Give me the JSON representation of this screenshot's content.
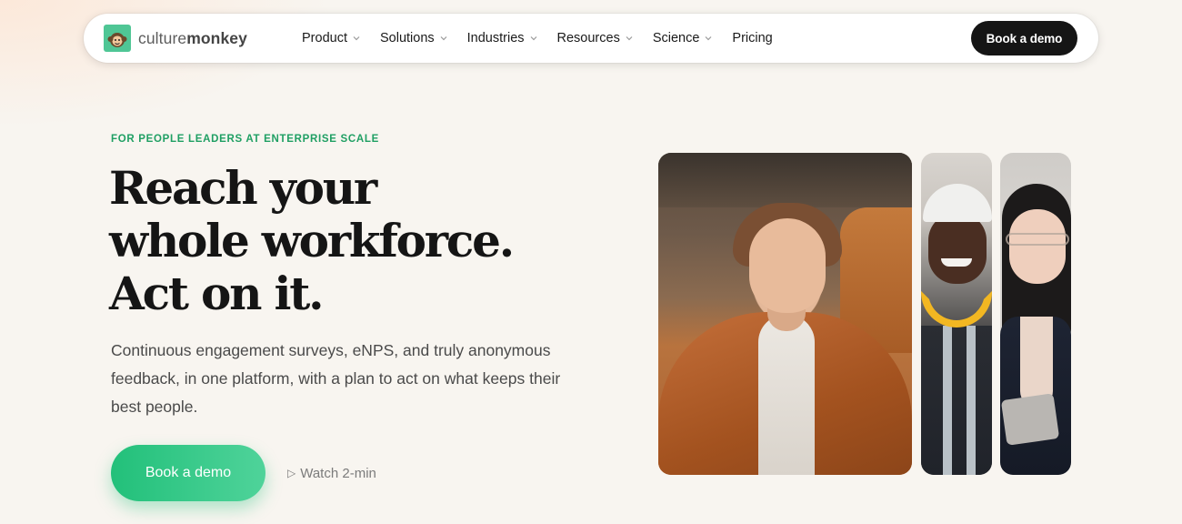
{
  "brand": {
    "name_light": "culture",
    "name_bold": "monkey",
    "logo_color": "#4fc695"
  },
  "nav": {
    "items": [
      {
        "label": "Product",
        "has_dropdown": true
      },
      {
        "label": "Solutions",
        "has_dropdown": true
      },
      {
        "label": "Industries",
        "has_dropdown": true
      },
      {
        "label": "Resources",
        "has_dropdown": true
      },
      {
        "label": "Science",
        "has_dropdown": true
      },
      {
        "label": "Pricing",
        "has_dropdown": false
      }
    ],
    "cta_label": "Book a demo"
  },
  "hero": {
    "eyebrow": "FOR PEOPLE LEADERS AT ENTERPRISE SCALE",
    "headline_lines": [
      "Reach your",
      "whole workforce.",
      "Act on it."
    ],
    "subcopy": "Continuous engagement surveys, eNPS, and truly anonymous feedback, in one platform, with a plan to act on what keeps their best people.",
    "primary_cta": "Book a demo",
    "secondary_cta_icon": "play-icon",
    "secondary_cta": "Watch 2-min",
    "accent_color": "#1f9f63"
  },
  "photos": [
    {
      "name": "photo-woman-office"
    },
    {
      "name": "photo-worker-hardhat"
    },
    {
      "name": "photo-woman-tablet"
    }
  ]
}
